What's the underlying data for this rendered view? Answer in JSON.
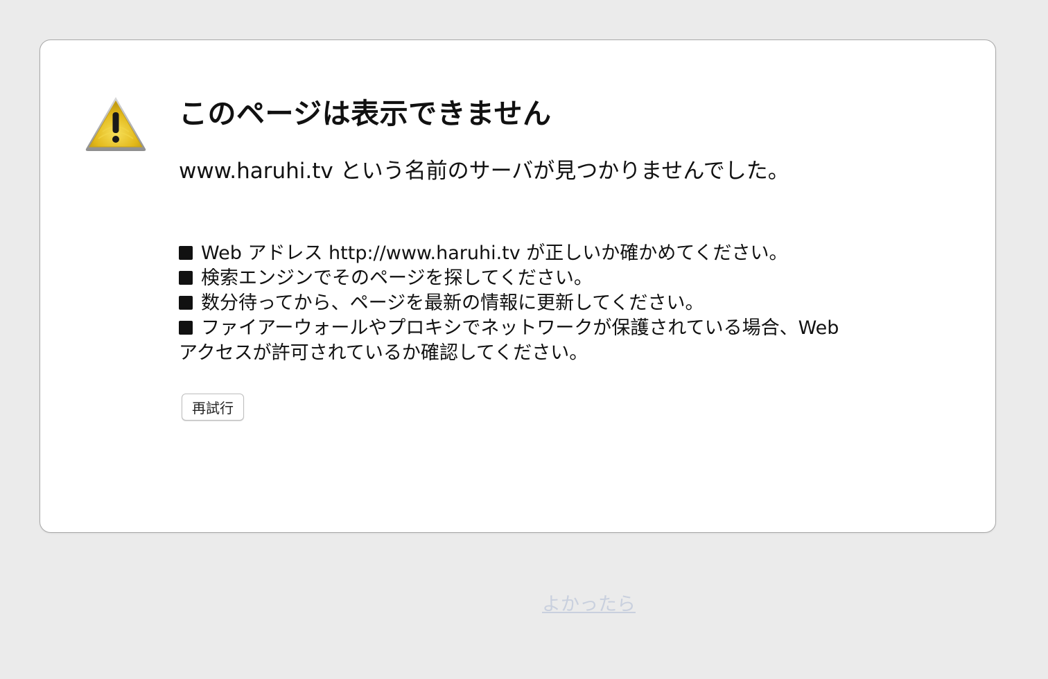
{
  "error": {
    "title": "このページは表示できません",
    "message": "www.haruhi.tv という名前のサーバが見つかりませんでした。",
    "tips": [
      "Web アドレス http://www.haruhi.tv が正しいか確かめてください。",
      "検索エンジンでそのページを探してください。",
      "数分待ってから、ページを最新の情報に更新してください。",
      "ファイアーウォールやプロキシでネットワークが保護されている場合、Web アクセスが許可されているか確認してください。"
    ],
    "retry_label": "再試行",
    "icon": "warning-icon"
  },
  "footer": {
    "link_label": "よかったら"
  },
  "colors": {
    "background": "#ebebeb",
    "card": "#ffffff",
    "icon_fill": "#e8c21c",
    "link": "#c9d0de"
  }
}
